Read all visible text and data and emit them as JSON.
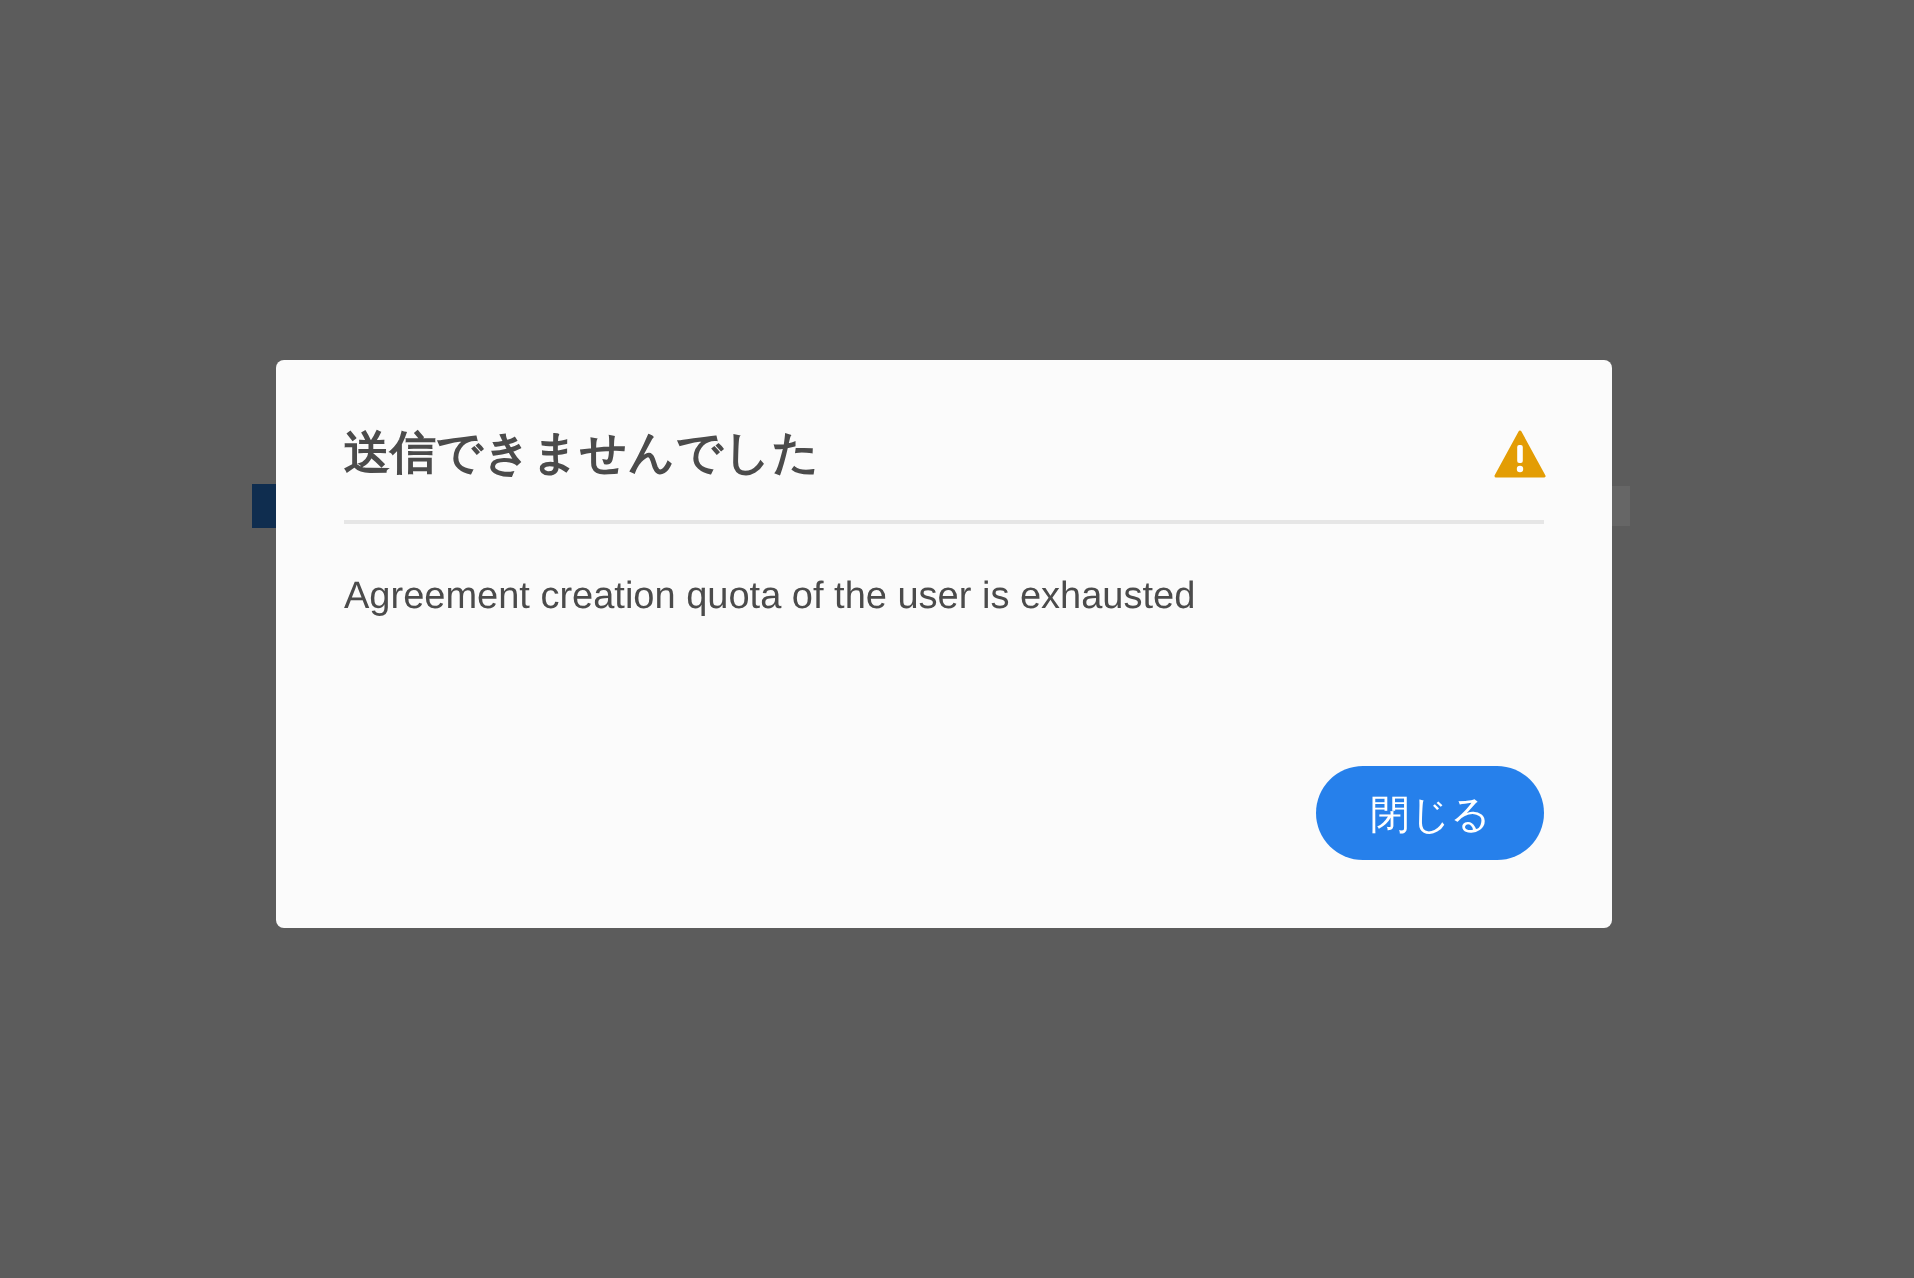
{
  "dialog": {
    "title": "送信できませんでした",
    "message": "Agreement creation quota of the user is exhausted",
    "buttons": [
      {
        "label": "閉じる",
        "kind": "primary"
      }
    ]
  }
}
